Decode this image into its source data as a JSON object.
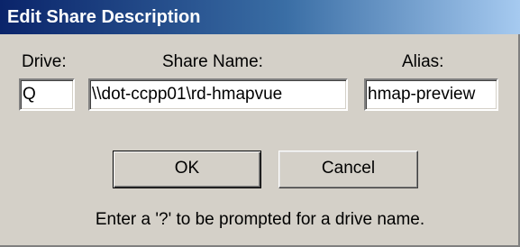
{
  "dialog": {
    "title": "Edit Share Description"
  },
  "labels": {
    "drive": "Drive:",
    "share_name": "Share Name:",
    "alias": "Alias:"
  },
  "fields": {
    "drive_value": "Q",
    "share_name_value": "\\\\dot-ccpp01\\rd-hmapvue",
    "alias_value": "hmap-preview"
  },
  "buttons": {
    "ok_label": "OK",
    "cancel_label": "Cancel"
  },
  "hint_text": "Enter a '?' to be prompted for a drive name.",
  "colors": {
    "title_gradient_start": "#0a246a",
    "title_gradient_end": "#a6caf0",
    "dialog_background": "#d4d0c8"
  }
}
